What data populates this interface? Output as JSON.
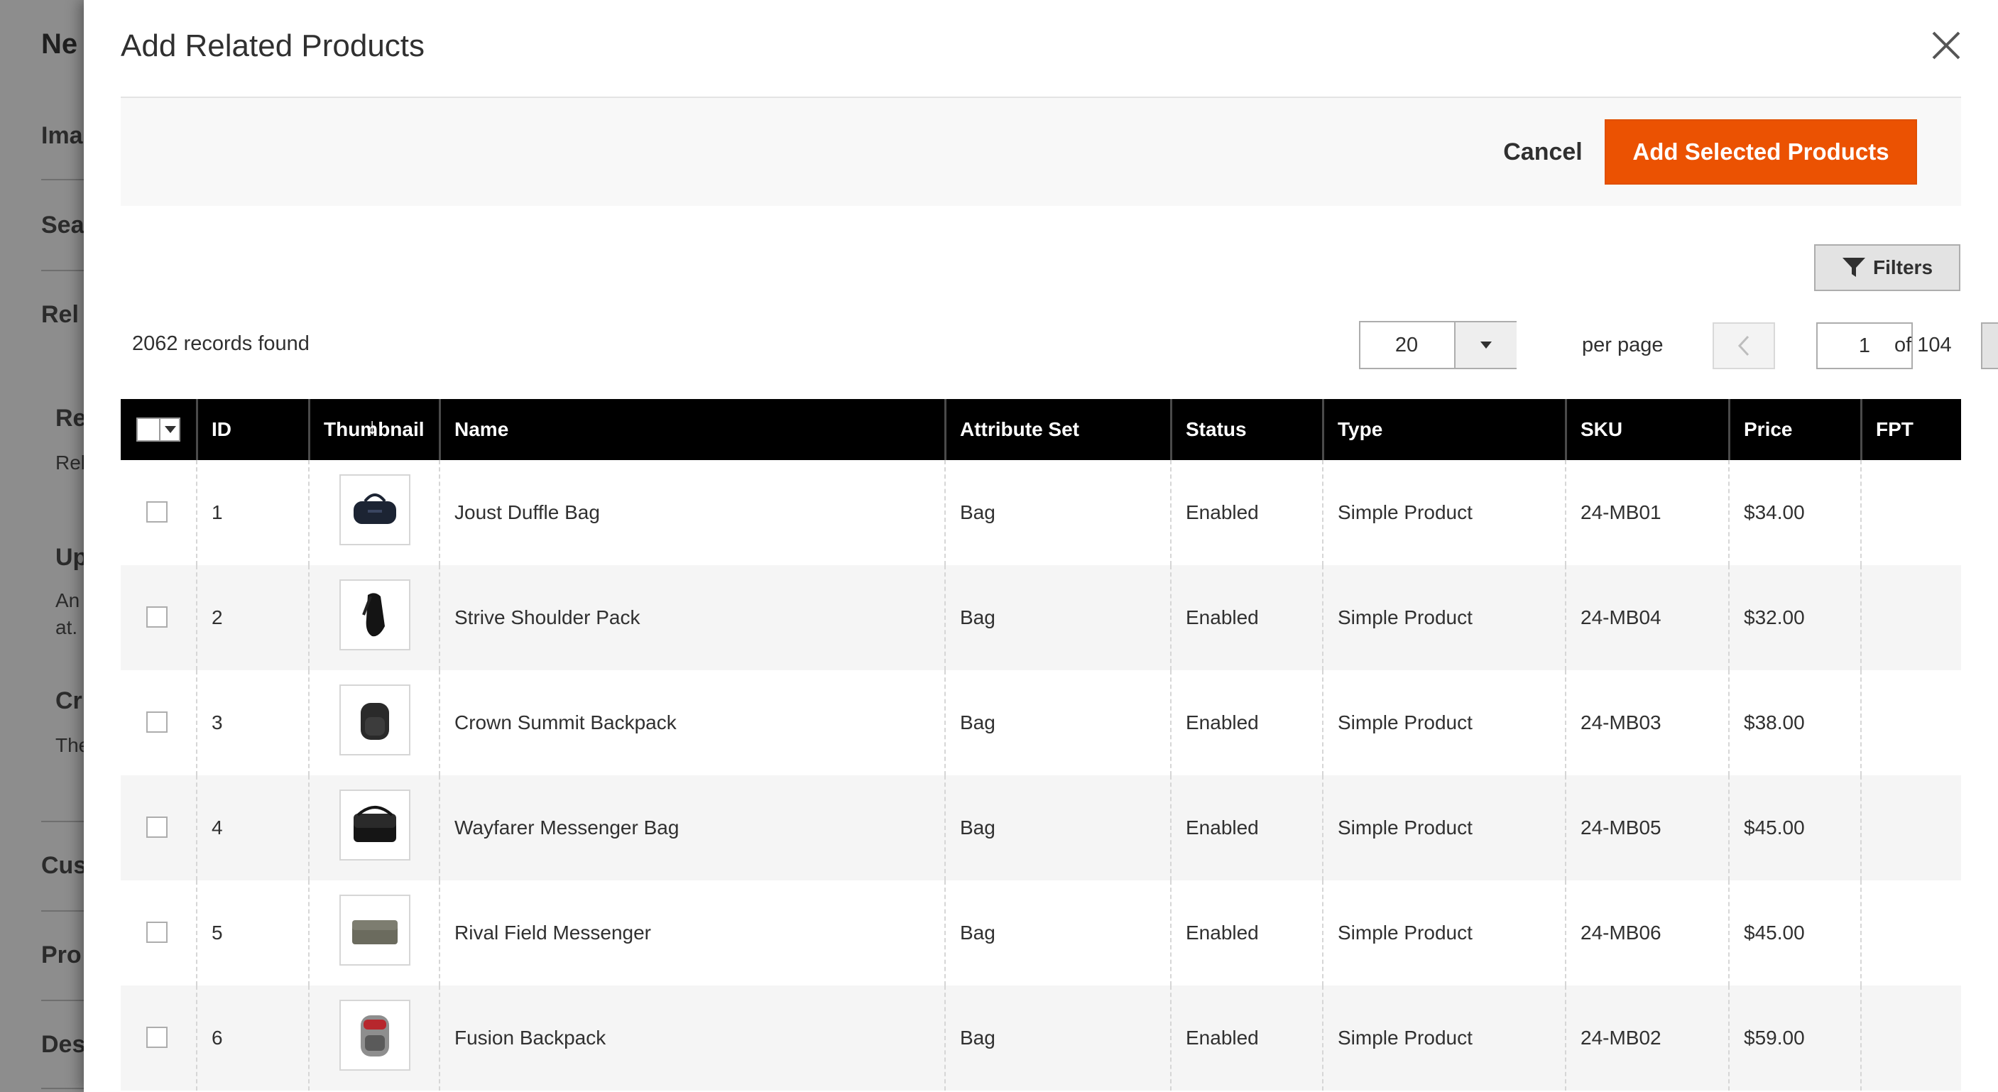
{
  "background": {
    "title": "Ne",
    "sections": [
      "Ima",
      "Sea",
      "Rel",
      "Cus",
      "Pro",
      "Des"
    ],
    "subsections": [
      {
        "heading": "Re",
        "text": "Rel"
      },
      {
        "heading": "Up",
        "text": "An",
        "text2": "at."
      },
      {
        "heading": "Cr",
        "text": "The"
      }
    ]
  },
  "modal": {
    "title": "Add Related Products",
    "cancel_label": "Cancel",
    "add_label": "Add Selected Products",
    "filters_label": "Filters"
  },
  "pager": {
    "records_found": "2062 records found",
    "per_page_value": "20",
    "per_page_label": "per page",
    "current_page": "1",
    "of_pages": "of 104"
  },
  "grid": {
    "columns": [
      "ID",
      "Thumbnail",
      "Name",
      "Attribute Set",
      "Status",
      "Type",
      "SKU",
      "Price",
      "FPT"
    ],
    "rows": [
      {
        "id": "1",
        "name": "Joust Duffle Bag",
        "attribute_set": "Bag",
        "status": "Enabled",
        "type": "Simple Product",
        "sku": "24-MB01",
        "price": "$34.00",
        "fpt": "",
        "thumb": "duffle-bag"
      },
      {
        "id": "2",
        "name": "Strive Shoulder Pack",
        "attribute_set": "Bag",
        "status": "Enabled",
        "type": "Simple Product",
        "sku": "24-MB04",
        "price": "$32.00",
        "fpt": "",
        "thumb": "shoulder-pack"
      },
      {
        "id": "3",
        "name": "Crown Summit Backpack",
        "attribute_set": "Bag",
        "status": "Enabled",
        "type": "Simple Product",
        "sku": "24-MB03",
        "price": "$38.00",
        "fpt": "",
        "thumb": "backpack"
      },
      {
        "id": "4",
        "name": "Wayfarer Messenger Bag",
        "attribute_set": "Bag",
        "status": "Enabled",
        "type": "Simple Product",
        "sku": "24-MB05",
        "price": "$45.00",
        "fpt": "",
        "thumb": "messenger-bag"
      },
      {
        "id": "5",
        "name": "Rival Field Messenger",
        "attribute_set": "Bag",
        "status": "Enabled",
        "type": "Simple Product",
        "sku": "24-MB06",
        "price": "$45.00",
        "fpt": "",
        "thumb": "field-messenger"
      },
      {
        "id": "6",
        "name": "Fusion Backpack",
        "attribute_set": "Bag",
        "status": "Enabled",
        "type": "Simple Product",
        "sku": "24-MB02",
        "price": "$59.00",
        "fpt": "",
        "thumb": "fusion-backpack"
      }
    ]
  },
  "colors": {
    "accent": "#eb5202",
    "header_bg": "#000000",
    "overlay": "#8d8d8d"
  }
}
